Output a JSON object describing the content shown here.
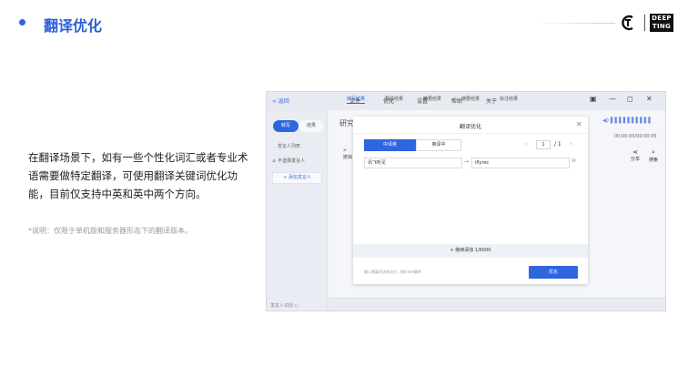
{
  "header": {
    "title": "翻译优化",
    "brand_logo": "DEEP\nTING"
  },
  "description": "在翻译场景下，如有一些个性化词汇或者专业术语需要做特定翻译，可使用翻译关键词优化功能，目前仅支持中英和英中两个方向。",
  "note": "*说明：仅限于单机版和服务器形态下的翻译版本。",
  "app": {
    "back_label": "< 返回",
    "menu": [
      "文件",
      "优化",
      "设置",
      "帮助",
      "关于"
    ],
    "window_controls": [
      "▣",
      "—",
      "◻",
      "✕"
    ],
    "sidebar": {
      "seg_a": "转写",
      "seg_b": "结果",
      "heading": "发言人列表",
      "user": "不选择发言人",
      "add_button": "+ 添加发言人",
      "footer": "发言人识别 ○"
    },
    "ghost_text": "研究",
    "ghost_icon_label": "撤销",
    "volume": "◀) ▌▌▌▌▌▌▌▌▌▌",
    "timer": "00:00:00/00:00:05",
    "share_label": "分享",
    "search_label": "搜索",
    "bottom_tabs": [
      "转写结果",
      "翻译结果",
      "摘要结果",
      "摘要结果",
      "标注结果"
    ]
  },
  "dialog": {
    "title": "翻译优化",
    "close": "✕",
    "tab_zh_en": "中译英",
    "tab_en_zh": "英译中",
    "page_current": "1",
    "page_total": "/ 1",
    "source_value": "讯飞听见",
    "target_value": "iflyrec",
    "add_row": "+ 继续添加 1/6000",
    "hint": "输入需要优化的词对，按Enter翻译",
    "optimize_button": "优化"
  },
  "colors": {
    "accent": "#2f66e0",
    "title": "#2a5fd6"
  }
}
